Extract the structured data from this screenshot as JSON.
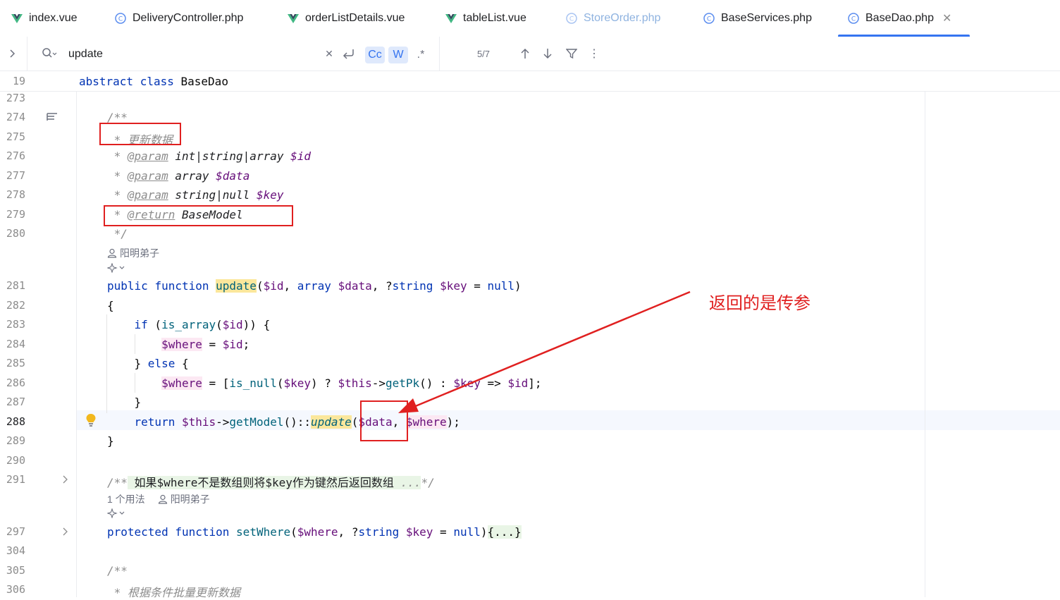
{
  "tabs": [
    {
      "label": "index.vue",
      "type": "vue"
    },
    {
      "label": "DeliveryController.php",
      "type": "php"
    },
    {
      "label": "orderListDetails.vue",
      "type": "vue"
    },
    {
      "label": "tableList.vue",
      "type": "vue"
    },
    {
      "label": "StoreOrder.php",
      "type": "php"
    },
    {
      "label": "BaseServices.php",
      "type": "php"
    },
    {
      "label": "BaseDao.php",
      "type": "php",
      "active": true
    }
  ],
  "search": {
    "query": "update",
    "match_case_label": "Cc",
    "words_label": "W",
    "regex_label": ".*",
    "result_count": "5/7"
  },
  "sticky_header": {
    "line_number": "19",
    "keyword1": "abstract",
    "keyword2": "class",
    "class_name": "BaseDao"
  },
  "line_numbers": {
    "l273": "273",
    "l274": "274",
    "l275": "275",
    "l276": "276",
    "l277": "277",
    "l278": "278",
    "l279": "279",
    "l280": "280",
    "l281": "281",
    "l282": "282",
    "l283": "283",
    "l284": "284",
    "l285": "285",
    "l286": "286",
    "l287": "287",
    "l288": "288",
    "l289": "289",
    "l290": "290",
    "l291": "291",
    "l297": "297",
    "l304": "304",
    "l305": "305",
    "l306": "306"
  },
  "doc_comment": {
    "open": "/**",
    "summary": "更新数据",
    "param1_type": "int|string|array",
    "param1_var": "$id",
    "param2_type": "array",
    "param2_var": "$data",
    "param3_type": "string|null",
    "param3_var": "$key",
    "param_tag": "@param",
    "return_tag": "@return",
    "return_type": "BaseModel",
    "close": "*/"
  },
  "author_hint": "阳明弟子",
  "second_doc": {
    "open": "/**",
    "text": "如果$where不是数组则将$key作为键然后返回数组",
    "ellipsis": "...",
    "close": "*/"
  },
  "usage_hint": "1 个用法",
  "third_doc": {
    "open": "/**",
    "text": "根据条件批量更新数据"
  },
  "annotation": {
    "text": "返回的是传参"
  },
  "colors": {
    "keyword": "#0033b3",
    "variable": "#660e7a",
    "function": "#00627a",
    "comment": "#8c8c8c",
    "search_highlight": "#fbe79c",
    "annotation_red": "#e02020",
    "accent": "#3574f0"
  }
}
